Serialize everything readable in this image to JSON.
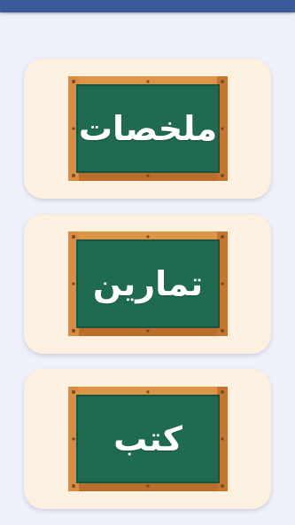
{
  "app_bar": {
    "title": ""
  },
  "menu": [
    {
      "label": "ملخصات"
    },
    {
      "label": "تمارين"
    },
    {
      "label": "كتب"
    }
  ],
  "colors": {
    "background": "#eef1fa",
    "card": "#fcf1e0",
    "board_green": "#1f6b52",
    "frame_wood": "#d28a3c"
  }
}
